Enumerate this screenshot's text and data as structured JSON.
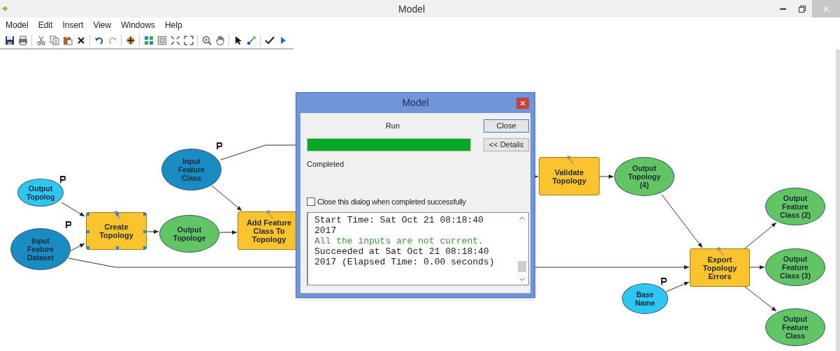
{
  "window": {
    "title": "Model"
  },
  "menu": [
    "Model",
    "Edit",
    "Insert",
    "View",
    "Windows",
    "Help"
  ],
  "toolbar": [
    {
      "kind": "save"
    },
    {
      "kind": "print"
    },
    {
      "kind": "cut"
    },
    {
      "kind": "copy"
    },
    {
      "kind": "paste"
    },
    {
      "kind": "delete"
    },
    {
      "kind": "undo"
    },
    {
      "kind": "redo"
    },
    {
      "kind": "add"
    },
    {
      "kind": "layout"
    },
    {
      "kind": "extent"
    },
    {
      "kind": "collapse"
    },
    {
      "kind": "expand"
    },
    {
      "kind": "zoom"
    },
    {
      "kind": "pan"
    },
    {
      "kind": "select"
    },
    {
      "kind": "connect"
    },
    {
      "kind": "validate"
    },
    {
      "kind": "run"
    }
  ],
  "diagram": {
    "nodes": [
      {
        "kind": "data",
        "label": "Input Feature Class",
        "color": "#1a8cc4",
        "parameter": true,
        "selected": false
      },
      {
        "kind": "tool",
        "label": "Validate Topology",
        "color": "#fbc32e",
        "parameter": false,
        "selected": false
      },
      {
        "kind": "data",
        "label": "Output Topology (4)",
        "color": "#62c563",
        "parameter": false,
        "selected": false
      },
      {
        "kind": "data",
        "label": "Output Topolog",
        "color": "#2ec6f2",
        "parameter": true,
        "selected": false
      },
      {
        "kind": "data",
        "label": "Output Feature Class (2)",
        "color": "#62c563",
        "parameter": false,
        "selected": false
      },
      {
        "kind": "tool",
        "label": "Create Topology",
        "color": "#fbc32e",
        "parameter": false,
        "selected": true
      },
      {
        "kind": "data",
        "label": "Output Topologe",
        "color": "#62c563",
        "parameter": false,
        "selected": false
      },
      {
        "kind": "tool",
        "label": "Add Feature Class To Topology",
        "color": "#fbc32e",
        "parameter": false,
        "selected": false
      },
      {
        "kind": "data",
        "label": "Input Feature Dataset",
        "color": "#1a8cc4",
        "parameter": true,
        "selected": false
      },
      {
        "kind": "tool",
        "label": "Export Topology Errors",
        "color": "#fbc32e",
        "parameter": false,
        "selected": false
      },
      {
        "kind": "data",
        "label": "Output Feature Class (3)",
        "color": "#62c563",
        "parameter": false,
        "selected": false
      },
      {
        "kind": "data",
        "label": "Base Name",
        "color": "#2ec6f2",
        "parameter": true,
        "selected": false
      },
      {
        "kind": "data",
        "label": "Output Feature Class",
        "color": "#62c563",
        "parameter": false,
        "selected": false
      }
    ]
  },
  "dialog": {
    "title": "Model",
    "status": "Run",
    "progress": {
      "level": 1
    },
    "result": "Completed",
    "buttons": [
      "Close",
      "<< Details"
    ],
    "close_when_done": {
      "label": "Close this dialog when completed successfully",
      "checked": false
    },
    "log": [
      {
        "kind": "message",
        "text": "Start Time: Sat Oct 21 08:18:40 2017"
      },
      {
        "kind": "warning",
        "text": "All the inputs are not current."
      },
      {
        "kind": "message",
        "text": "Succeeded at Sat Oct 21 08:18:40 2017 (Elapsed Time: 0.00 seconds)"
      }
    ]
  }
}
